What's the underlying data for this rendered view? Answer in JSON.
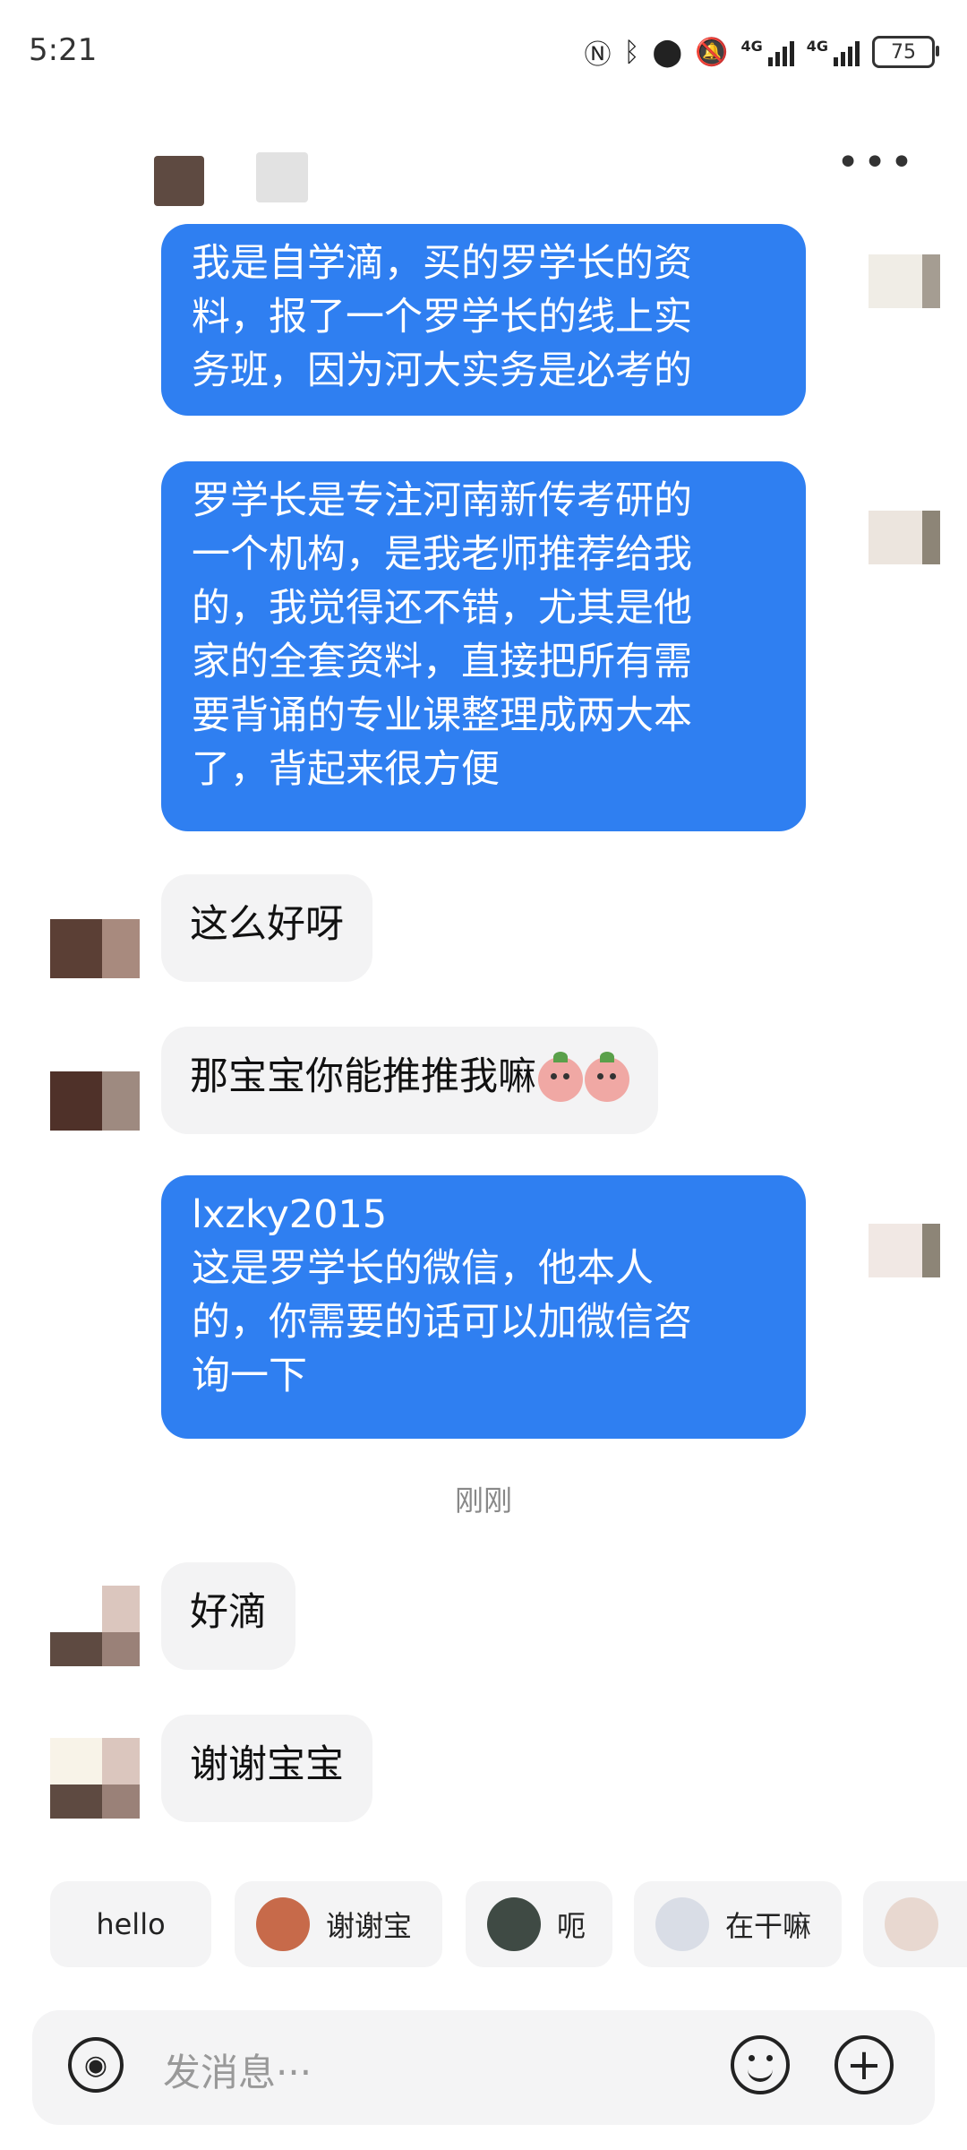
{
  "status_bar": {
    "time": "5:21",
    "network_1": "4G",
    "network_2": "4G",
    "battery": "75"
  },
  "messages": [
    {
      "side": "out",
      "text": "我是自学滴，买的罗学长的资\n料，报了一个罗学长的线上实\n务班，因为河大实务是必考的"
    },
    {
      "side": "out",
      "text": "罗学长是专注河南新传考研的\n一个机构，是我老师推荐给我\n的，我觉得还不错，尤其是他\n家的全套资料，直接把所有需\n要背诵的专业课整理成两大本\n了，背起来很方便"
    },
    {
      "side": "in",
      "text": "这么好呀"
    },
    {
      "side": "in",
      "text": "那宝宝你能推推我嘛"
    },
    {
      "side": "out",
      "text": "lxzky2015\n这是罗学长的微信，他本人\n的，你需要的话可以加微信咨\n询一下"
    },
    {
      "side": "in",
      "text": "好滴"
    },
    {
      "side": "in",
      "text": "谢谢宝宝"
    }
  ],
  "timestamp": "刚刚",
  "quick_replies": [
    {
      "label": "hello",
      "icon": ""
    },
    {
      "label": "谢谢宝",
      "icon": "monkey-sticker-icon"
    },
    {
      "label": "呃",
      "icon": "cat-sticker-icon"
    },
    {
      "label": "在干嘛",
      "icon": "cartoon-sticker-icon"
    }
  ],
  "input": {
    "placeholder": "发消息···"
  },
  "colors": {
    "outgoing_bubble": "#2f7ff1",
    "incoming_bubble": "#f3f3f4"
  }
}
